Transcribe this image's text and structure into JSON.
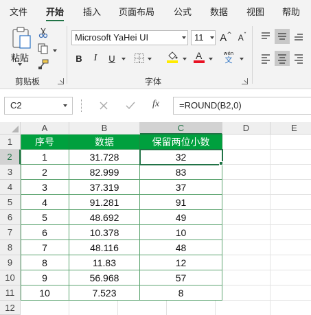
{
  "ribbon_tabs": [
    "文件",
    "开始",
    "插入",
    "页面布局",
    "公式",
    "数据",
    "视图",
    "帮助"
  ],
  "active_tab": "开始",
  "clipboard": {
    "paste_label": "粘贴",
    "group_label": "剪贴板"
  },
  "font": {
    "name": "Microsoft YaHei UI",
    "size": "11",
    "group_label": "字体",
    "bold": "B",
    "italic": "I",
    "underline": "U",
    "grow": "A",
    "shrink": "A",
    "wen_top": "wén",
    "wen_bottom": "文"
  },
  "formula_bar": {
    "name_box": "C2",
    "fx": "fx",
    "formula": "=ROUND(B2,0)"
  },
  "columns": [
    "A",
    "B",
    "C",
    "D",
    "E"
  ],
  "rows": [
    "1",
    "2",
    "3",
    "4",
    "5",
    "6",
    "7",
    "8",
    "9",
    "10",
    "11",
    "12"
  ],
  "table": {
    "headers": [
      "序号",
      "数据",
      "保留两位小数"
    ],
    "data": [
      [
        "1",
        "31.728",
        "32"
      ],
      [
        "2",
        "82.999",
        "83"
      ],
      [
        "3",
        "37.319",
        "37"
      ],
      [
        "4",
        "91.281",
        "91"
      ],
      [
        "5",
        "48.692",
        "49"
      ],
      [
        "6",
        "10.378",
        "10"
      ],
      [
        "7",
        "48.116",
        "48"
      ],
      [
        "8",
        "11.83",
        "12"
      ],
      [
        "9",
        "56.968",
        "57"
      ],
      [
        "10",
        "7.523",
        "8"
      ]
    ]
  },
  "active_cell": "C2",
  "colors": {
    "accent": "#217346",
    "header_fill": "#00a03e",
    "highlight_yellow": "#ffeb00",
    "font_red": "#e81123"
  }
}
